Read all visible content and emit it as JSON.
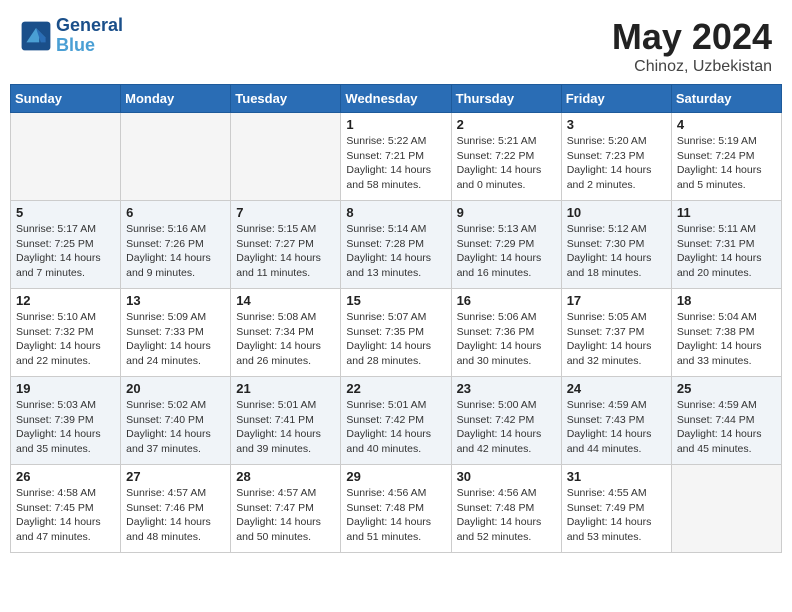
{
  "header": {
    "logo_line1": "General",
    "logo_line2": "Blue",
    "month": "May 2024",
    "location": "Chinoz, Uzbekistan"
  },
  "weekdays": [
    "Sunday",
    "Monday",
    "Tuesday",
    "Wednesday",
    "Thursday",
    "Friday",
    "Saturday"
  ],
  "weeks": [
    [
      {
        "day": "",
        "sunrise": "",
        "sunset": "",
        "daylight": ""
      },
      {
        "day": "",
        "sunrise": "",
        "sunset": "",
        "daylight": ""
      },
      {
        "day": "",
        "sunrise": "",
        "sunset": "",
        "daylight": ""
      },
      {
        "day": "1",
        "sunrise": "Sunrise: 5:22 AM",
        "sunset": "Sunset: 7:21 PM",
        "daylight": "Daylight: 14 hours and 58 minutes."
      },
      {
        "day": "2",
        "sunrise": "Sunrise: 5:21 AM",
        "sunset": "Sunset: 7:22 PM",
        "daylight": "Daylight: 14 hours and 0 minutes."
      },
      {
        "day": "3",
        "sunrise": "Sunrise: 5:20 AM",
        "sunset": "Sunset: 7:23 PM",
        "daylight": "Daylight: 14 hours and 2 minutes."
      },
      {
        "day": "4",
        "sunrise": "Sunrise: 5:19 AM",
        "sunset": "Sunset: 7:24 PM",
        "daylight": "Daylight: 14 hours and 5 minutes."
      }
    ],
    [
      {
        "day": "5",
        "sunrise": "Sunrise: 5:17 AM",
        "sunset": "Sunset: 7:25 PM",
        "daylight": "Daylight: 14 hours and 7 minutes."
      },
      {
        "day": "6",
        "sunrise": "Sunrise: 5:16 AM",
        "sunset": "Sunset: 7:26 PM",
        "daylight": "Daylight: 14 hours and 9 minutes."
      },
      {
        "day": "7",
        "sunrise": "Sunrise: 5:15 AM",
        "sunset": "Sunset: 7:27 PM",
        "daylight": "Daylight: 14 hours and 11 minutes."
      },
      {
        "day": "8",
        "sunrise": "Sunrise: 5:14 AM",
        "sunset": "Sunset: 7:28 PM",
        "daylight": "Daylight: 14 hours and 13 minutes."
      },
      {
        "day": "9",
        "sunrise": "Sunrise: 5:13 AM",
        "sunset": "Sunset: 7:29 PM",
        "daylight": "Daylight: 14 hours and 16 minutes."
      },
      {
        "day": "10",
        "sunrise": "Sunrise: 5:12 AM",
        "sunset": "Sunset: 7:30 PM",
        "daylight": "Daylight: 14 hours and 18 minutes."
      },
      {
        "day": "11",
        "sunrise": "Sunrise: 5:11 AM",
        "sunset": "Sunset: 7:31 PM",
        "daylight": "Daylight: 14 hours and 20 minutes."
      }
    ],
    [
      {
        "day": "12",
        "sunrise": "Sunrise: 5:10 AM",
        "sunset": "Sunset: 7:32 PM",
        "daylight": "Daylight: 14 hours and 22 minutes."
      },
      {
        "day": "13",
        "sunrise": "Sunrise: 5:09 AM",
        "sunset": "Sunset: 7:33 PM",
        "daylight": "Daylight: 14 hours and 24 minutes."
      },
      {
        "day": "14",
        "sunrise": "Sunrise: 5:08 AM",
        "sunset": "Sunset: 7:34 PM",
        "daylight": "Daylight: 14 hours and 26 minutes."
      },
      {
        "day": "15",
        "sunrise": "Sunrise: 5:07 AM",
        "sunset": "Sunset: 7:35 PM",
        "daylight": "Daylight: 14 hours and 28 minutes."
      },
      {
        "day": "16",
        "sunrise": "Sunrise: 5:06 AM",
        "sunset": "Sunset: 7:36 PM",
        "daylight": "Daylight: 14 hours and 30 minutes."
      },
      {
        "day": "17",
        "sunrise": "Sunrise: 5:05 AM",
        "sunset": "Sunset: 7:37 PM",
        "daylight": "Daylight: 14 hours and 32 minutes."
      },
      {
        "day": "18",
        "sunrise": "Sunrise: 5:04 AM",
        "sunset": "Sunset: 7:38 PM",
        "daylight": "Daylight: 14 hours and 33 minutes."
      }
    ],
    [
      {
        "day": "19",
        "sunrise": "Sunrise: 5:03 AM",
        "sunset": "Sunset: 7:39 PM",
        "daylight": "Daylight: 14 hours and 35 minutes."
      },
      {
        "day": "20",
        "sunrise": "Sunrise: 5:02 AM",
        "sunset": "Sunset: 7:40 PM",
        "daylight": "Daylight: 14 hours and 37 minutes."
      },
      {
        "day": "21",
        "sunrise": "Sunrise: 5:01 AM",
        "sunset": "Sunset: 7:41 PM",
        "daylight": "Daylight: 14 hours and 39 minutes."
      },
      {
        "day": "22",
        "sunrise": "Sunrise: 5:01 AM",
        "sunset": "Sunset: 7:42 PM",
        "daylight": "Daylight: 14 hours and 40 minutes."
      },
      {
        "day": "23",
        "sunrise": "Sunrise: 5:00 AM",
        "sunset": "Sunset: 7:42 PM",
        "daylight": "Daylight: 14 hours and 42 minutes."
      },
      {
        "day": "24",
        "sunrise": "Sunrise: 4:59 AM",
        "sunset": "Sunset: 7:43 PM",
        "daylight": "Daylight: 14 hours and 44 minutes."
      },
      {
        "day": "25",
        "sunrise": "Sunrise: 4:59 AM",
        "sunset": "Sunset: 7:44 PM",
        "daylight": "Daylight: 14 hours and 45 minutes."
      }
    ],
    [
      {
        "day": "26",
        "sunrise": "Sunrise: 4:58 AM",
        "sunset": "Sunset: 7:45 PM",
        "daylight": "Daylight: 14 hours and 47 minutes."
      },
      {
        "day": "27",
        "sunrise": "Sunrise: 4:57 AM",
        "sunset": "Sunset: 7:46 PM",
        "daylight": "Daylight: 14 hours and 48 minutes."
      },
      {
        "day": "28",
        "sunrise": "Sunrise: 4:57 AM",
        "sunset": "Sunset: 7:47 PM",
        "daylight": "Daylight: 14 hours and 50 minutes."
      },
      {
        "day": "29",
        "sunrise": "Sunrise: 4:56 AM",
        "sunset": "Sunset: 7:48 PM",
        "daylight": "Daylight: 14 hours and 51 minutes."
      },
      {
        "day": "30",
        "sunrise": "Sunrise: 4:56 AM",
        "sunset": "Sunset: 7:48 PM",
        "daylight": "Daylight: 14 hours and 52 minutes."
      },
      {
        "day": "31",
        "sunrise": "Sunrise: 4:55 AM",
        "sunset": "Sunset: 7:49 PM",
        "daylight": "Daylight: 14 hours and 53 minutes."
      },
      {
        "day": "",
        "sunrise": "",
        "sunset": "",
        "daylight": ""
      }
    ]
  ]
}
